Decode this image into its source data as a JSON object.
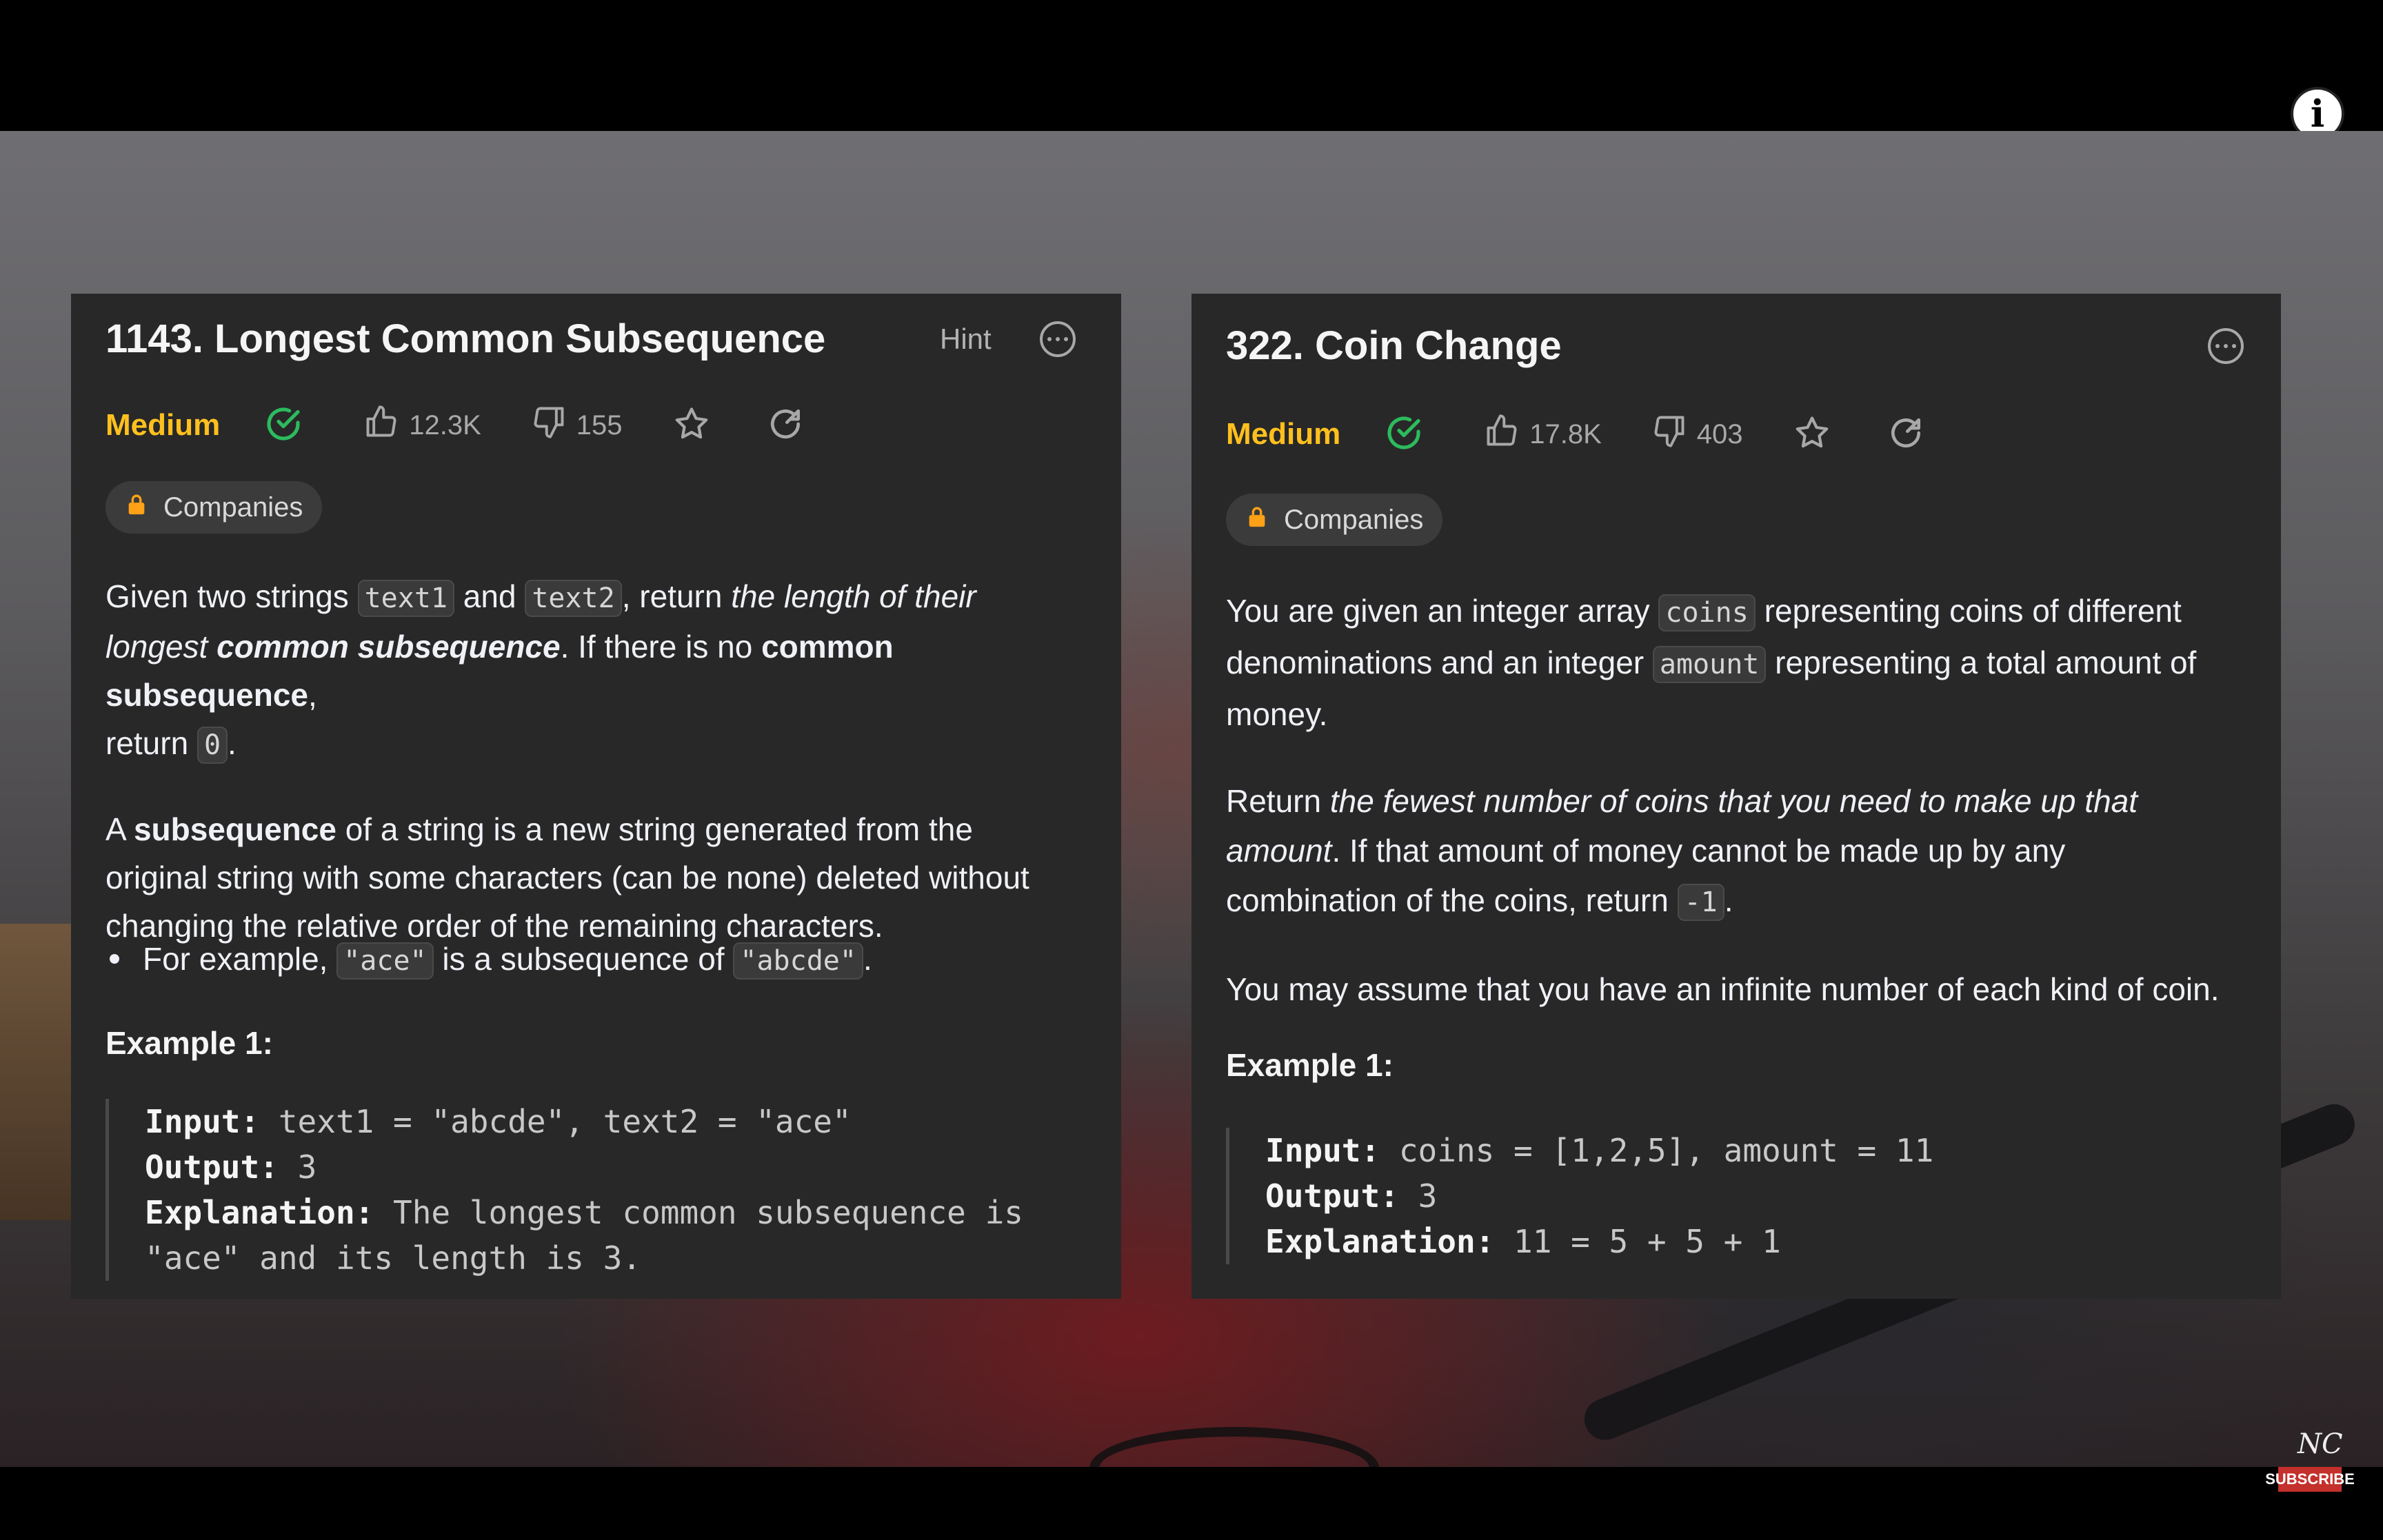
{
  "left_problem": {
    "title": "1143. Longest Common Subsequence",
    "hint_label": "Hint",
    "difficulty": "Medium",
    "likes": "12.3K",
    "dislikes": "155",
    "companies_label": "Companies",
    "desc": {
      "p1_a": "Given two strings ",
      "code_text1": "text1",
      "p1_b": " and ",
      "code_text2": "text2",
      "p1_c": ", return ",
      "p1_em1": "the length of their",
      "p1_em2": "longest ",
      "p1_em_strong": "common subsequence",
      "p1_d": ". If there is no ",
      "p1_strong": "common subsequence",
      "p1_e": ",",
      "p1_f": "return ",
      "code_zero": "0",
      "p1_g": ".",
      "p2_a": "A ",
      "p2_strong": "subsequence",
      "p2_b": " of a string is a new string generated from the",
      "p2_line2": "original string with some characters (can be none) deleted without",
      "p2_line3": "changing the relative order of the remaining characters."
    },
    "bullet": {
      "a": "For example, ",
      "code1": "\"ace\"",
      "b": " is a subsequence of ",
      "code2": "\"abcde\"",
      "c": "."
    },
    "example_heading": "Example 1:",
    "example": {
      "input_label": "Input:",
      "input_value": " text1 = \"abcde\", text2 = \"ace\"",
      "output_label": "Output:",
      "output_value": " 3",
      "explanation_label": "Explanation:",
      "explanation_value": " The longest common subsequence is",
      "explanation_line2": "\"ace\" and its length is 3."
    }
  },
  "right_problem": {
    "title": "322. Coin Change",
    "difficulty": "Medium",
    "likes": "17.8K",
    "dislikes": "403",
    "companies_label": "Companies",
    "desc": {
      "p1_a": "You are given an integer array ",
      "code_coins": "coins",
      "p1_b": " representing coins of different",
      "p1_c": "denominations and an integer ",
      "code_amount": "amount",
      "p1_d": " representing a total amount of",
      "p1_e": "money.",
      "p2_a": "Return ",
      "p2_em1": "the fewest number of coins that you need to make up that",
      "p2_em2": "amount",
      "p2_b": ". If that amount of money cannot be made up by any",
      "p2_c": "combination of the coins, return ",
      "code_neg1": "-1",
      "p2_d": ".",
      "p3": "You may assume that you have an infinite number of each kind of coin."
    },
    "example_heading": "Example 1:",
    "example": {
      "input_label": "Input:",
      "input_value": " coins = [1,2,5], amount = 11",
      "output_label": "Output:",
      "output_value": " 3",
      "explanation_label": "Explanation:",
      "explanation_value": " 11 = 5 + 5 + 1"
    }
  },
  "overlay": {
    "info_glyph": "i",
    "channel_mark": "NC",
    "subscribe_label": "SUBSCRIBE"
  },
  "colors": {
    "panel_bg": "#282828",
    "difficulty_medium": "#ffc01e",
    "solved_check": "#2cbb5d",
    "subscribe_red": "#c4302b"
  },
  "icons": [
    "info-icon",
    "more-options-icon",
    "check-circle-icon",
    "thumbs-up-icon",
    "thumbs-down-icon",
    "star-icon",
    "share-icon",
    "lock-icon"
  ]
}
